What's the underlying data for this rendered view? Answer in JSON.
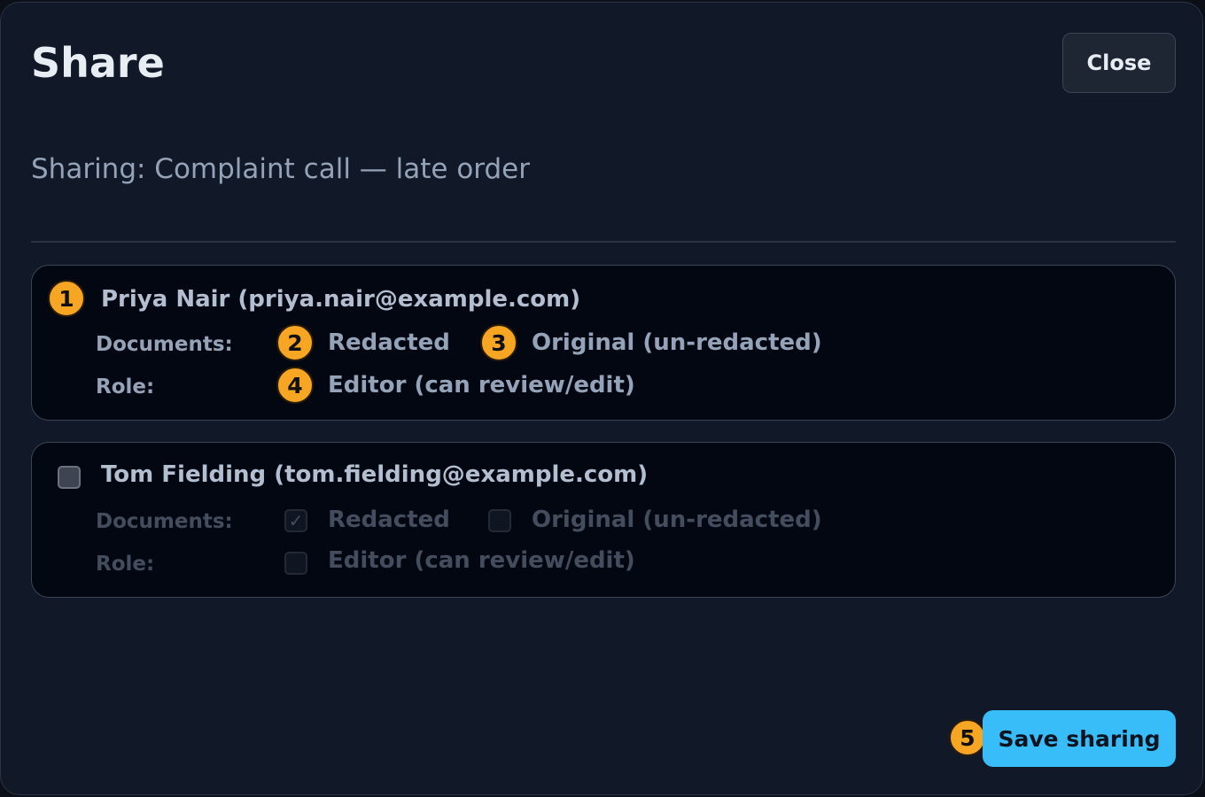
{
  "dialog": {
    "title": "Share",
    "close_label": "Close",
    "subtitle": "Sharing: Complaint call — late order"
  },
  "users": [
    {
      "name": "Priya Nair (priya.nair@example.com)",
      "selected": true,
      "documents_label": "Documents:",
      "role_label": "Role:",
      "options": {
        "redacted": "Redacted",
        "original": "Original (un-redacted)",
        "editor": "Editor (can review/edit)"
      }
    },
    {
      "name": "Tom Fielding (tom.fielding@example.com)",
      "selected": false,
      "documents_label": "Documents:",
      "role_label": "Role:",
      "options": {
        "redacted": "Redacted",
        "original": "Original (un-redacted)",
        "editor": "Editor (can review/edit)"
      },
      "option_states": {
        "redacted": true,
        "original": false,
        "editor": false
      }
    }
  ],
  "badges": [
    "1",
    "2",
    "3",
    "4",
    "5"
  ],
  "save_label": "Save sharing",
  "colors": {
    "background": "#111827",
    "card": "#030712",
    "badge": "#f6a623",
    "primary_button": "#38bdf8"
  },
  "icons": {
    "checkmark": "check-icon"
  }
}
